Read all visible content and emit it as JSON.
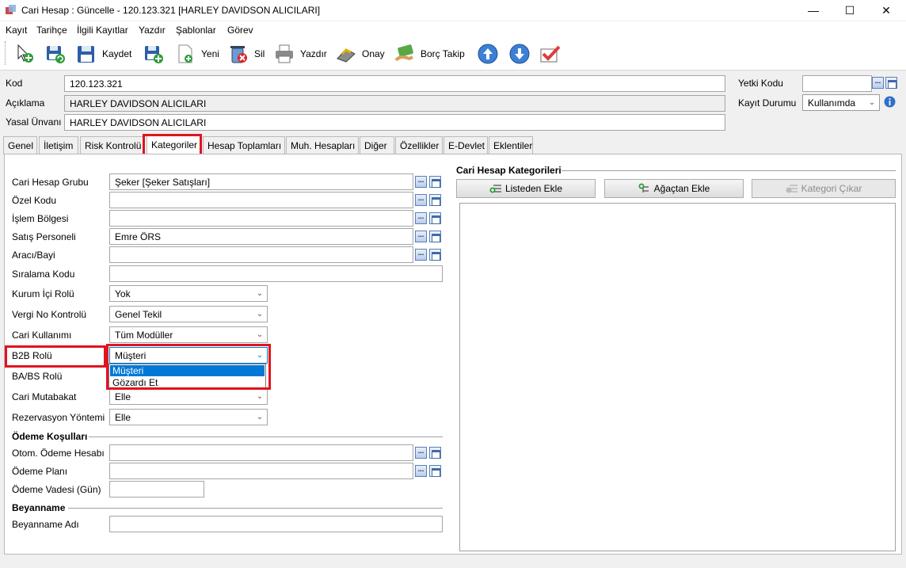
{
  "window": {
    "title": "Cari Hesap : Güncelle - 120.123.321 [HARLEY DAVIDSON ALICILARI]",
    "minimize": "—",
    "maximize": "☐",
    "close": "✕"
  },
  "menu": [
    "Kayıt",
    "Tarihçe",
    "İlgili Kayıtlar",
    "Yazdır",
    "Şablonlar",
    "Görev"
  ],
  "toolbar": {
    "kaydet": "Kaydet",
    "yeni": "Yeni",
    "sil": "Sil",
    "yazdir": "Yazdır",
    "onay": "Onay",
    "borc_takip": "Borç Takip"
  },
  "header": {
    "kod_label": "Kod",
    "kod_value": "120.123.321",
    "aciklama_label": "Açıklama",
    "aciklama_value": "HARLEY DAVIDSON ALICILARI",
    "yasal_label": "Yasal Ünvanı",
    "yasal_value": "HARLEY DAVIDSON ALICILARI",
    "yetki_label": "Yetki Kodu",
    "yetki_value": "",
    "kayit_durumu_label": "Kayıt Durumu",
    "kayit_durumu_value": "Kullanımda"
  },
  "tabs": [
    "Genel",
    "İletişim",
    "Risk Kontrolü",
    "Kategoriler",
    "Hesap Toplamları",
    "Muh. Hesapları",
    "Diğer",
    "Özellikler",
    "E-Devlet",
    "Eklentiler"
  ],
  "active_tab": "Kategoriler",
  "form": {
    "cari_hesap_grubu_label": "Cari Hesap Grubu",
    "cari_hesap_grubu_value": "Şeker [Şeker Satışları]",
    "ozel_kodu_label": "Özel Kodu",
    "ozel_kodu_value": "",
    "islem_bolgesi_label": "İşlem Bölgesi",
    "islem_bolgesi_value": "",
    "satis_personeli_label": "Satış Personeli",
    "satis_personeli_value": "Emre ÖRS",
    "araci_bayi_label": "Aracı/Bayi",
    "araci_bayi_value": "",
    "siralama_kodu_label": "Sıralama Kodu",
    "siralama_kodu_value": "",
    "kurum_ici_rolu_label": "Kurum İçi Rolü",
    "kurum_ici_rolu_value": "Yok",
    "vergi_no_kontrolu_label": "Vergi No Kontrolü",
    "vergi_no_kontrolu_value": "Genel Tekil",
    "cari_kullanimi_label": "Cari Kullanımı",
    "cari_kullanimi_value": "Tüm Modüller",
    "b2b_rolu_label": "B2B Rolü",
    "b2b_rolu_value": "Müşteri",
    "babs_rolu_label": "BA/BS Rolü",
    "cari_mutabakat_label": "Cari Mutabakat",
    "cari_mutabakat_value": "Elle",
    "rezervasyon_label": "Rezervasyon Yöntemi",
    "rezervasyon_value": "Elle",
    "odeme_kosullari_header": "Ödeme Koşulları",
    "otom_odeme_label": "Otom. Ödeme Hesabı",
    "otom_odeme_value": "",
    "odeme_plani_label": "Ödeme Planı",
    "odeme_plani_value": "",
    "odeme_vadesi_label": "Ödeme Vadesi (Gün)",
    "odeme_vadesi_value": "",
    "beyanname_header": "Beyanname",
    "beyanname_adi_label": "Beyanname Adı",
    "beyanname_adi_value": ""
  },
  "dropdown": {
    "options": [
      "Müşteri",
      "Gözardı Et"
    ],
    "selected": "Müşteri"
  },
  "categories": {
    "header": "Cari Hesap Kategorileri",
    "listeden_ekle": "Listeden Ekle",
    "agactan_ekle": "Ağaçtan Ekle",
    "kategori_cikar": "Kategori Çıkar"
  },
  "lookup_button": "...",
  "colors": {
    "highlight": "#e0141e",
    "selection": "#0078d7"
  }
}
